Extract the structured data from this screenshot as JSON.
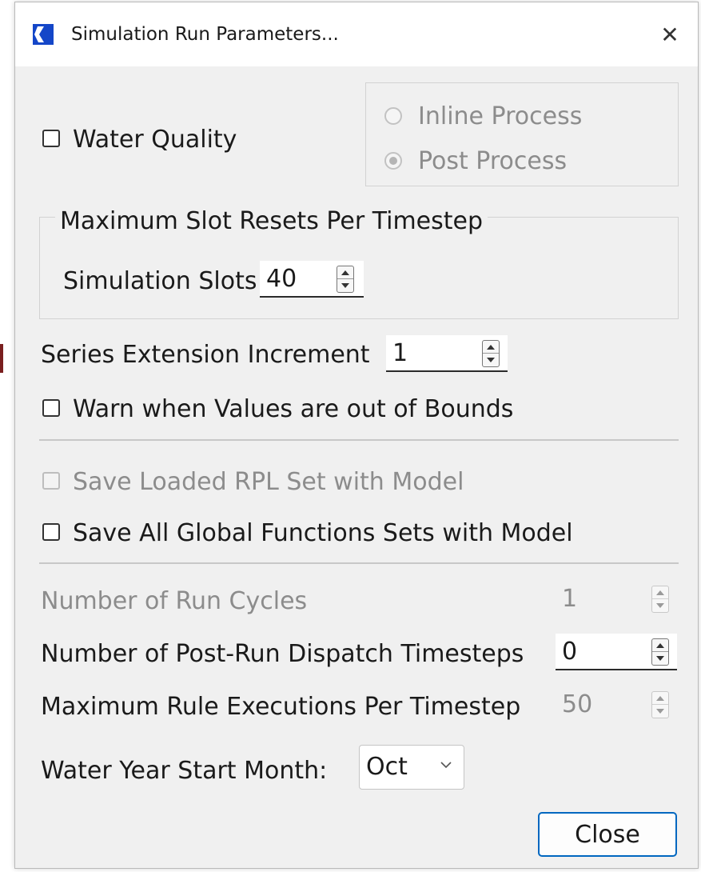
{
  "window": {
    "title": "Simulation Run Parameters...",
    "close_glyph": "✕",
    "accent_color": "#0067c0"
  },
  "water_quality": {
    "label": "Water Quality",
    "checked": false,
    "process_options": [
      {
        "label": "Inline Process",
        "selected": false,
        "enabled": false
      },
      {
        "label": "Post Process",
        "selected": true,
        "enabled": false
      }
    ]
  },
  "slot_resets": {
    "group_title": "Maximum Slot Resets Per Timestep",
    "simulation_slots_label": "Simulation Slots",
    "simulation_slots_value": "40"
  },
  "series_extension": {
    "label": "Series Extension Increment",
    "value": "1"
  },
  "warn_bounds": {
    "label": "Warn when Values are out of Bounds",
    "checked": false
  },
  "save_rpl": {
    "label": "Save Loaded RPL Set with Model",
    "checked": false,
    "enabled": false
  },
  "save_global": {
    "label": "Save All Global Functions Sets with Model",
    "checked": false
  },
  "run_cycles": {
    "label": "Number of Run Cycles",
    "value": "1",
    "enabled": false
  },
  "post_run_dispatch": {
    "label": "Number of Post-Run Dispatch Timesteps",
    "value": "0"
  },
  "max_rule_exec": {
    "label": "Maximum Rule Executions Per Timestep",
    "value": "50",
    "enabled": false
  },
  "water_year": {
    "label": "Water Year Start Month:",
    "value": "Oct"
  },
  "buttons": {
    "close": "Close"
  }
}
